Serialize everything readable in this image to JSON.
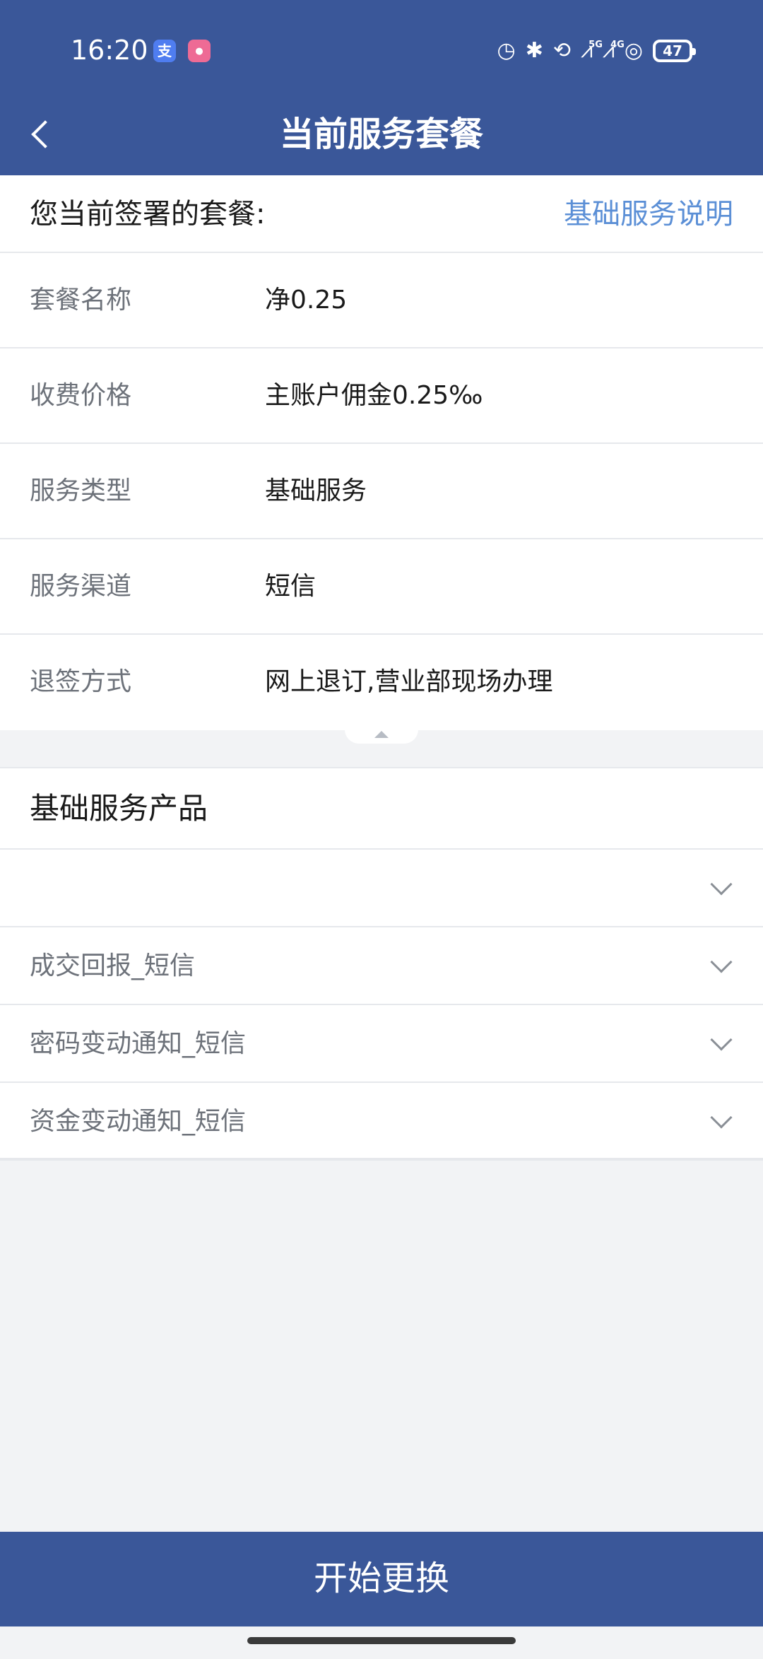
{
  "status_bar": {
    "time": "16:20",
    "badge1_glyph": "支",
    "badge2_glyph": "⏺",
    "icons": [
      "alarm-icon",
      "bluetooth-icon",
      "nfc-icon",
      "signal-5g-icon",
      "signal-4g-icon",
      "hotspot-icon"
    ],
    "label_5g": "5G",
    "label_4g": "4G",
    "battery": "47"
  },
  "nav": {
    "title": "当前服务套餐"
  },
  "plan_card": {
    "heading": "您当前签署的套餐:",
    "link": "基础服务说明",
    "rows": [
      {
        "key": "套餐名称",
        "value": "净0.25"
      },
      {
        "key": "收费价格",
        "value": "主账户佣金0.25‰"
      },
      {
        "key": "服务类型",
        "value": "基础服务"
      },
      {
        "key": "服务渠道",
        "value": "短信"
      },
      {
        "key": "退签方式",
        "value": "网上退订,营业部现场办理"
      }
    ]
  },
  "products": {
    "title": "基础服务产品",
    "items": [
      {
        "name": ""
      },
      {
        "name": "成交回报_短信"
      },
      {
        "name": "密码变动通知_短信"
      },
      {
        "name": "资金变动通知_短信"
      }
    ]
  },
  "footer": {
    "button_label": "开始更换"
  },
  "colors": {
    "primary": "#3a5799",
    "link": "#5b8fd6",
    "background": "#f2f3f5"
  }
}
